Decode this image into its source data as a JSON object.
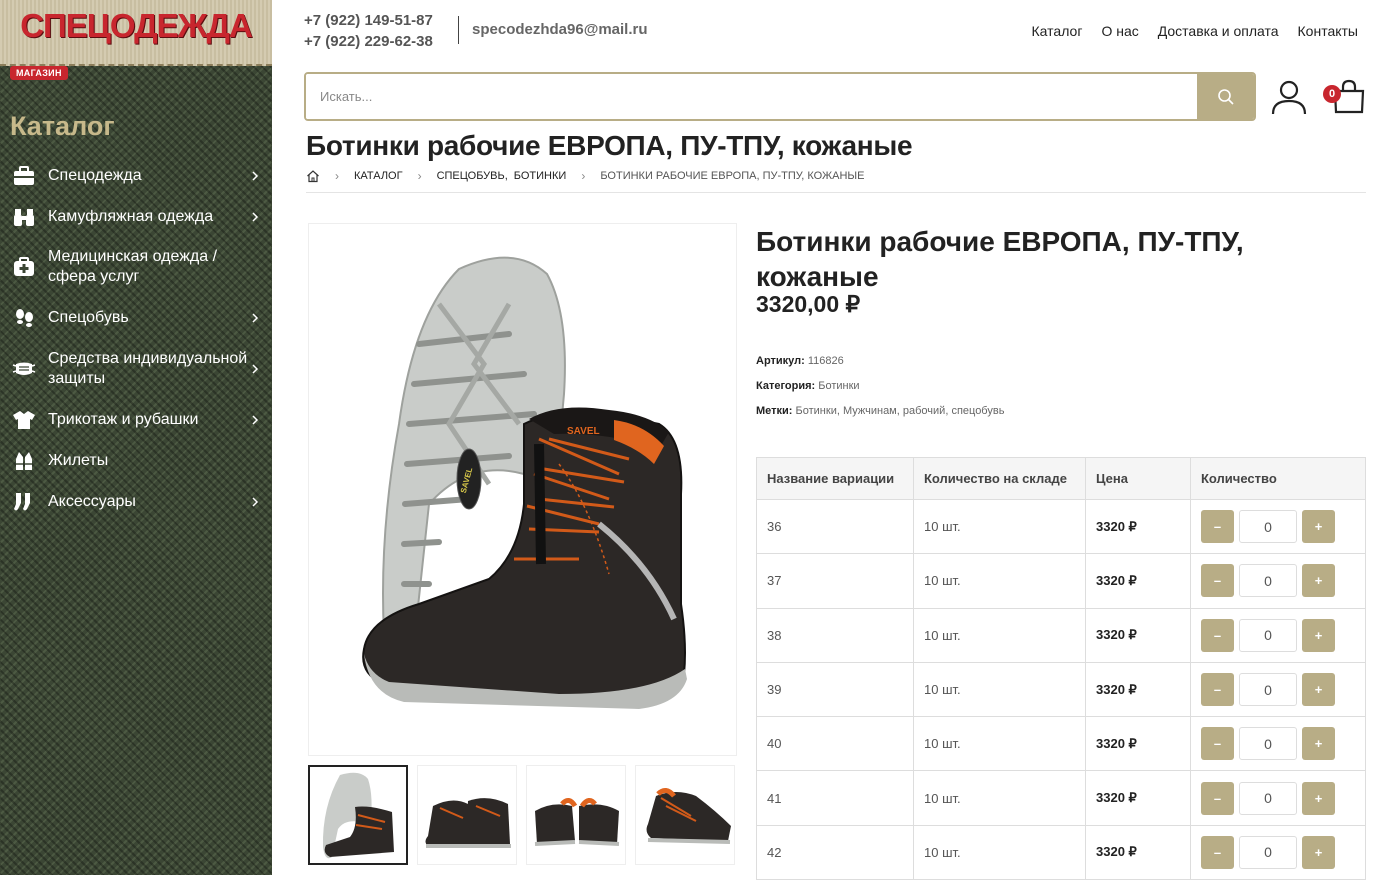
{
  "brand": {
    "logo_text": "СПЕЦОДЕЖДА",
    "badge": "МАГАЗИН"
  },
  "sidebar": {
    "title": "Каталог",
    "items": [
      {
        "label": "Спецодежда",
        "icon": "briefcase-icon",
        "has_sub": true
      },
      {
        "label": "Камуфляжная одежда",
        "icon": "binoculars-icon",
        "has_sub": true
      },
      {
        "label": "Медицинская одежда / сфера услуг",
        "icon": "medkit-icon",
        "has_sub": false
      },
      {
        "label": "Спецобувь",
        "icon": "footprints-icon",
        "has_sub": true
      },
      {
        "label": "Средства индивидуальной защиты",
        "icon": "mask-icon",
        "has_sub": true
      },
      {
        "label": "Трикотаж и рубашки",
        "icon": "tshirt-icon",
        "has_sub": true
      },
      {
        "label": "Жилеты",
        "icon": "vest-icon",
        "has_sub": false
      },
      {
        "label": "Аксессуары",
        "icon": "socks-icon",
        "has_sub": true
      }
    ]
  },
  "header": {
    "phone1": "+7 (922) 149-51-87",
    "phone2": "+7 (922) 229-62-38",
    "email": "specodezhda96@mail.ru",
    "nav": [
      "Каталог",
      "О нас",
      "Доставка и оплата",
      "Контакты"
    ],
    "search_placeholder": "Искать...",
    "cart_count": "0"
  },
  "page": {
    "title": "Ботинки рабочие ЕВРОПА, ПУ-ТПУ, кожаные",
    "breadcrumb": {
      "catalog": "КАТАЛОГ",
      "cat1": "СПЕЦОБУВЬ",
      "cat2": "БОТИНКИ",
      "current": "БОТИНКИ РАБОЧИЕ ЕВРОПА, ПУ-ТПУ, КОЖАНЫЕ"
    }
  },
  "product": {
    "name": "Ботинки рабочие ЕВРОПА, ПУ-ТПУ, кожаные",
    "price": "3320,00 ₽",
    "image_brand": "SAVEL",
    "sku_label": "Артикул:",
    "sku": "116826",
    "category_label": "Категория:",
    "category": "Ботинки",
    "tags_label": "Метки:",
    "tags": [
      "Ботинки",
      "Мужчинам",
      "рабочий",
      "спецобувь"
    ]
  },
  "variations": {
    "headers": [
      "Название вариации",
      "Количество на складе",
      "Цена",
      "Количество"
    ],
    "rows": [
      {
        "size": "36",
        "stock": "10 шт.",
        "price": "3320 ₽",
        "qty": "0"
      },
      {
        "size": "37",
        "stock": "10 шт.",
        "price": "3320 ₽",
        "qty": "0"
      },
      {
        "size": "38",
        "stock": "10 шт.",
        "price": "3320 ₽",
        "qty": "0"
      },
      {
        "size": "39",
        "stock": "10 шт.",
        "price": "3320 ₽",
        "qty": "0"
      },
      {
        "size": "40",
        "stock": "10 шт.",
        "price": "3320 ₽",
        "qty": "0"
      },
      {
        "size": "41",
        "stock": "10 шт.",
        "price": "3320 ₽",
        "qty": "0"
      },
      {
        "size": "42",
        "stock": "10 шт.",
        "price": "3320 ₽",
        "qty": "0"
      }
    ],
    "minus": "–",
    "plus": "+"
  },
  "colors": {
    "accent": "#b8ad86",
    "brand_red": "#c8262e",
    "sidebar_bg": "#3b4634",
    "catalog_title": "#c7b98b"
  }
}
